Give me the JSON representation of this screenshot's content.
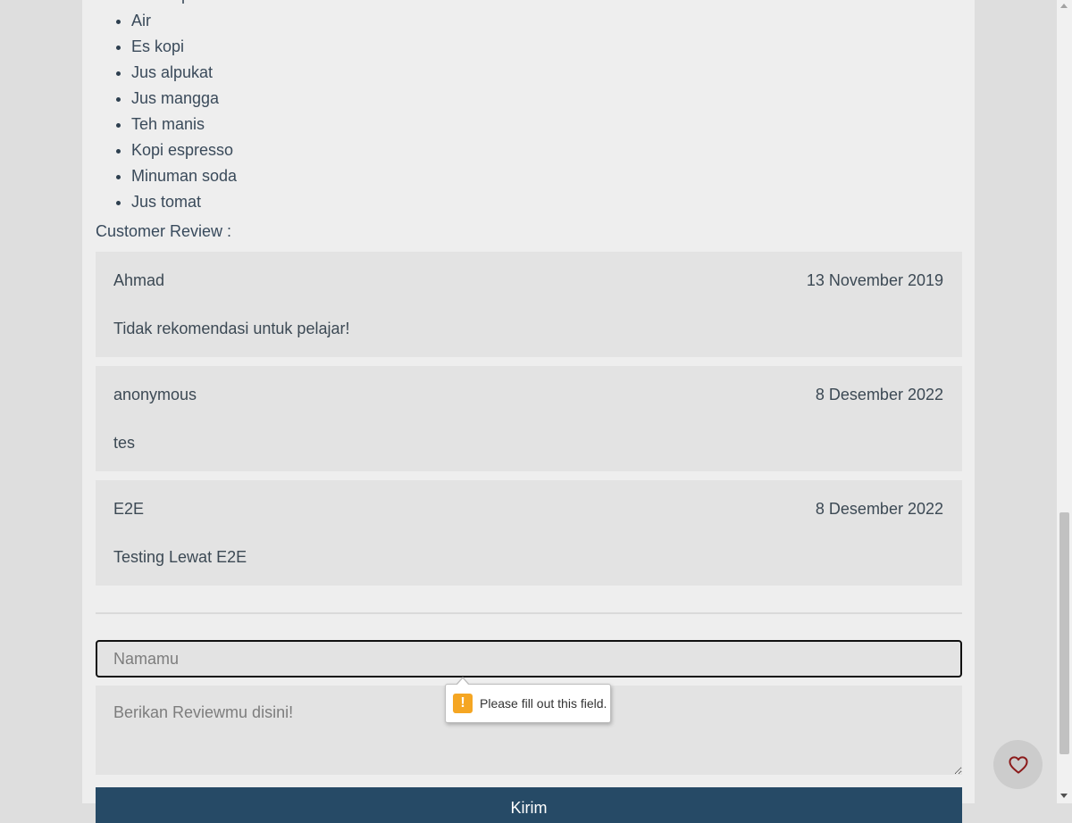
{
  "drinks": [
    "Coklat panas",
    "Air",
    "Es kopi",
    "Jus alpukat",
    "Jus mangga",
    "Teh manis",
    "Kopi espresso",
    "Minuman soda",
    "Jus tomat"
  ],
  "reviews": {
    "heading": "Customer Review :",
    "items": [
      {
        "name": "Ahmad",
        "date": "13 November 2019",
        "text": "Tidak rekomendasi untuk pelajar!"
      },
      {
        "name": "anonymous",
        "date": "8 Desember 2022",
        "text": "tes"
      },
      {
        "name": "E2E",
        "date": "8 Desember 2022",
        "text": "Testing Lewat E2E"
      }
    ]
  },
  "form": {
    "name_placeholder": "Namamu",
    "review_placeholder": "Berikan Reviewmu disini!",
    "submit_label": "Kirim"
  },
  "tooltip": {
    "text": "Please fill out this field.",
    "icon": "warning-icon",
    "icon_color": "#f5a623"
  },
  "favorite": {
    "icon": "heart-icon",
    "icon_color": "#8b1a1a"
  },
  "colors": {
    "button_bg": "#264a66",
    "page_bg": "#eeeeee",
    "card_bg": "#e3e3e3"
  }
}
